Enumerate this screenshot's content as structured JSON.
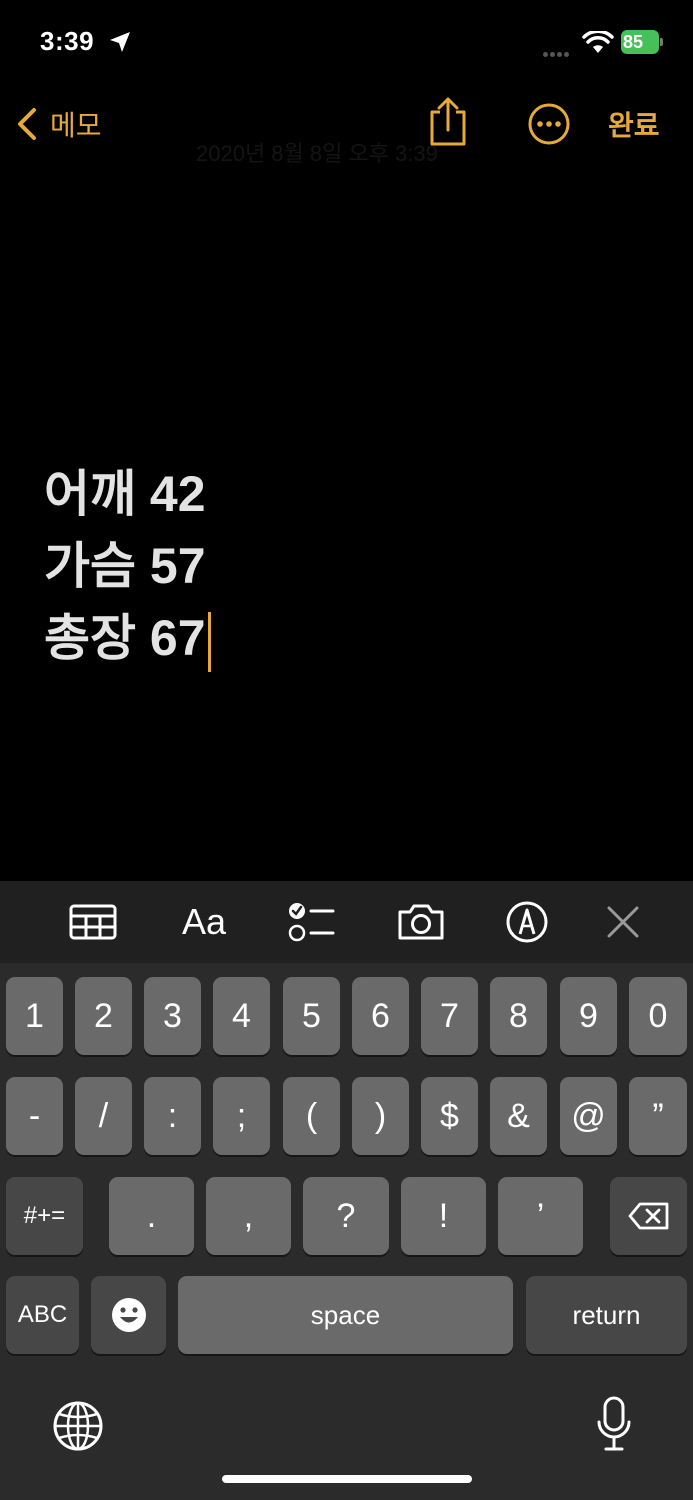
{
  "status": {
    "time": "3:39",
    "battery": "85",
    "icons": [
      "location-arrow-icon",
      "signal-dots-icon",
      "wifi-icon",
      "battery-charging-icon"
    ]
  },
  "nav": {
    "back_label": "메모",
    "done_label": "완료",
    "faint_date": "2020년 8월 8일 오후 3:39"
  },
  "note": {
    "lines": [
      "어깨 42",
      "가슴 57",
      "총장 67"
    ]
  },
  "toolbar": {
    "format_label": "Aa",
    "items": [
      "table-icon",
      "format-text",
      "checklist-icon",
      "camera-icon",
      "markup-pen-icon",
      "close-icon"
    ]
  },
  "keyboard": {
    "row1": [
      "1",
      "2",
      "3",
      "4",
      "5",
      "6",
      "7",
      "8",
      "9",
      "0"
    ],
    "row2": [
      "-",
      "/",
      ":",
      ";",
      "(",
      ")",
      "$",
      "&",
      "@",
      "”"
    ],
    "row3_left": "#+=",
    "row3": [
      ".",
      ",",
      "?",
      "!",
      "’"
    ],
    "abc_label": "ABC",
    "space_label": "space",
    "return_label": "return"
  },
  "colors": {
    "accent": "#e6a93a",
    "battery": "#45c05a",
    "key": "#6a6a6a",
    "key_dark": "#474747",
    "keyboard_bg": "#2b2b2b"
  }
}
